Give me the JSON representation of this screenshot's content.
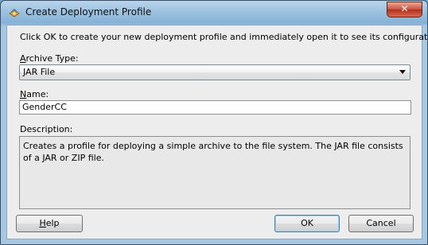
{
  "window": {
    "title": "Create Deployment Profile",
    "close_label": "✕",
    "icon": "deployment-profile-icon"
  },
  "dialog": {
    "instruction": "Click OK to create your new deployment profile and immediately open it to see its configuration.",
    "archive_type": {
      "label_mnemonic": "A",
      "label_rest": "rchive Type:",
      "selected": "JAR File"
    },
    "name": {
      "label_mnemonic": "N",
      "label_rest": "ame:",
      "value": "GenderCC"
    },
    "description": {
      "label": "Description:",
      "text": "Creates a profile for deploying a simple archive to the file system. The JAR file consists of a JAR or ZIP file."
    }
  },
  "buttons": {
    "help_mnemonic": "H",
    "help_rest": "elp",
    "ok": "OK",
    "cancel": "Cancel"
  }
}
